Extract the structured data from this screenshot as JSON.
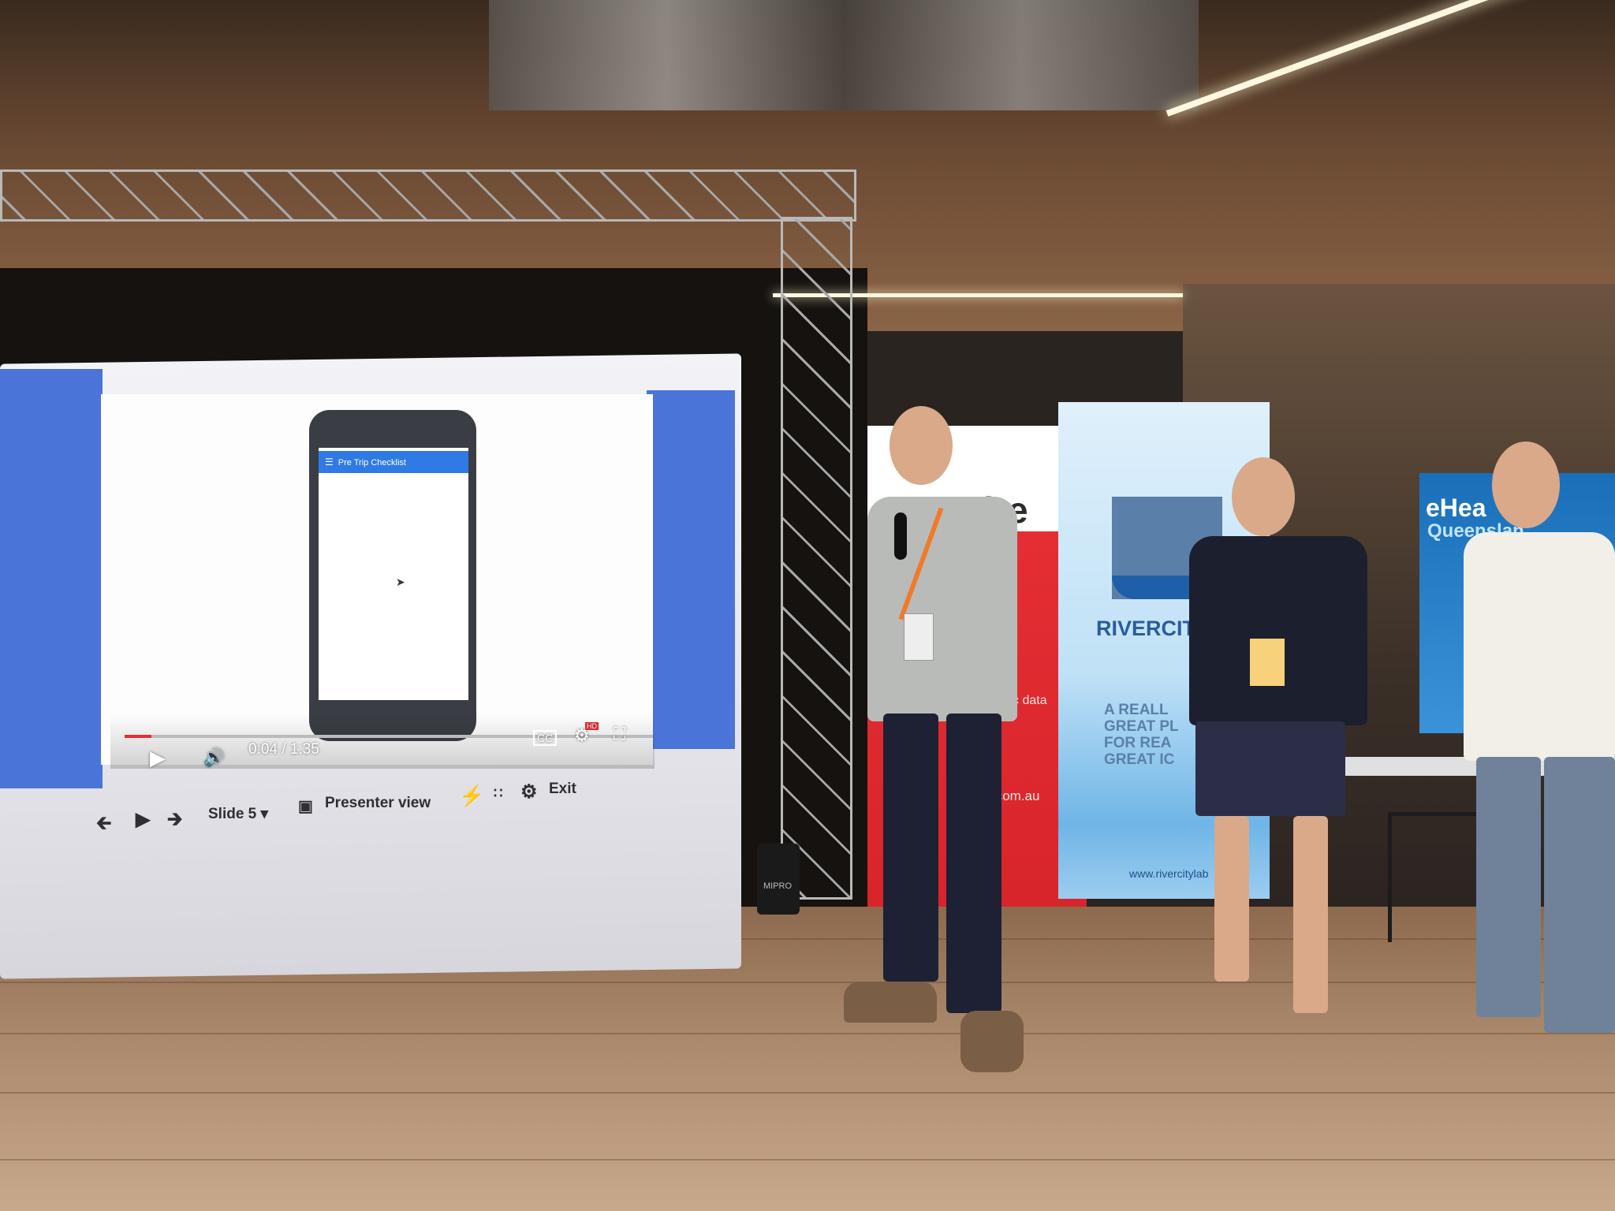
{
  "scene": {
    "video_overlay": {
      "app_title": "Pre Trip Checklist",
      "menu_icon": "hamburger-icon",
      "time": "0:04 / 1:35",
      "quality_badge": "HD"
    },
    "slides_toolbar": {
      "slide_label": "Slide 5",
      "presenter_view": "Presenter view",
      "exit": "Exit"
    },
    "banners": {
      "acquire_logo_text": "acquire",
      "acquire_tagline_fragment": "tific data",
      "acquire_url_fragment": ".com.au",
      "rivercity_name": "RIVERCITY",
      "rivercity_tagline": [
        "A REALL",
        "GREAT PL",
        "FOR REA",
        "GREAT IC"
      ],
      "rivercity_url": "www.rivercitylab",
      "ehealth_line1": "eHea",
      "ehealth_line2": "Queenslan",
      "speaker_brand": "MIPRO"
    },
    "colors": {
      "slides_blue": "#4a74d8",
      "app_bar_blue": "#2f7ae5",
      "acquire_red": "#e42e34",
      "rivercity_blue": "#2a5d9a",
      "lanyard_orange": "#f07a2a"
    }
  }
}
